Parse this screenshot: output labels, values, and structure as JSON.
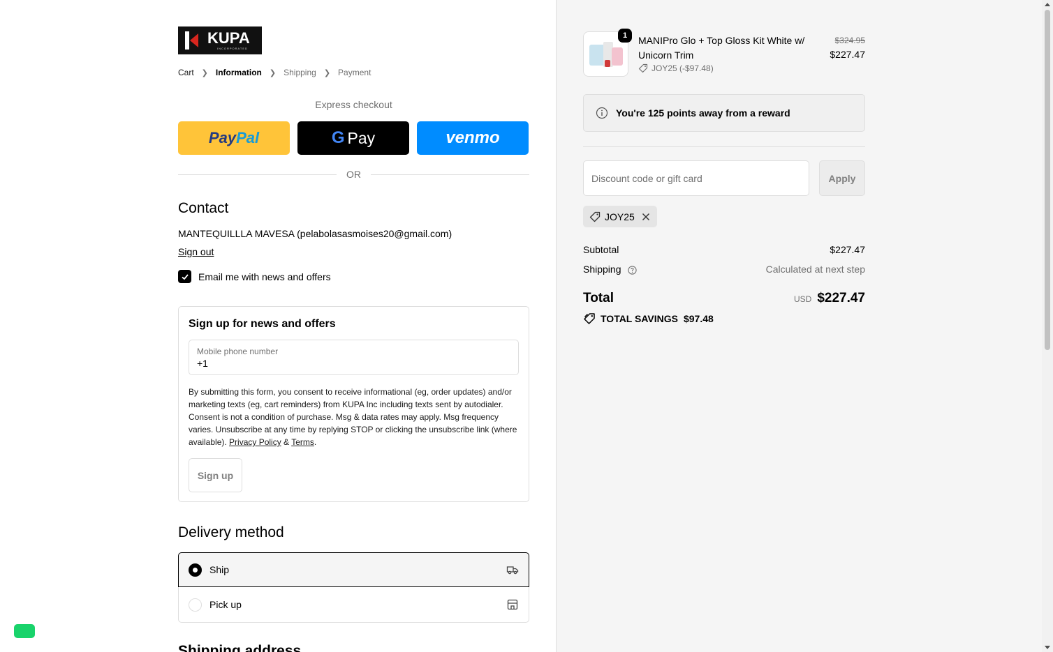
{
  "brand": {
    "logo_text": "KUPA",
    "logo_subtext": "INCORPORATED"
  },
  "breadcrumb": [
    {
      "label": "Cart",
      "state": "link"
    },
    {
      "label": "Information",
      "state": "current"
    },
    {
      "label": "Shipping",
      "state": "upcoming"
    },
    {
      "label": "Payment",
      "state": "upcoming"
    }
  ],
  "express": {
    "label": "Express checkout",
    "paypal": {
      "part1": "Pay",
      "part2": "Pal"
    },
    "gpay": {
      "g": "G",
      "pay": "Pay"
    },
    "venmo": "venmo",
    "or": "OR"
  },
  "contact": {
    "title": "Contact",
    "account": "MANTEQUILLLA MAVESA (pelabolasasmoises20@gmail.com)",
    "sign_out": "Sign out",
    "email_opt_in_label": "Email me with news and offers",
    "email_opt_in_checked": true
  },
  "sms_signup": {
    "title": "Sign up for news and offers",
    "phone_label": "Mobile phone number",
    "phone_value": "+1",
    "consent_text": "By submitting this form, you consent to receive informational (eg, order updates) and/or marketing texts (eg, cart reminders) from KUPA Inc including texts sent by autodialer. Consent is not a condition of purchase. Msg & data rates may apply. Msg frequency varies. Unsubscribe at any time by replying STOP or clicking the unsubscribe link (where available). ",
    "privacy_link": "Privacy Policy",
    "amp": " & ",
    "terms_link": "Terms",
    "period": ".",
    "button": "Sign up"
  },
  "delivery": {
    "title": "Delivery method",
    "options": [
      {
        "label": "Ship",
        "selected": true,
        "icon": "truck-icon"
      },
      {
        "label": "Pick up",
        "selected": false,
        "icon": "store-icon"
      }
    ]
  },
  "next_section_title": "Shipping address",
  "order": {
    "item": {
      "name": "MANIPro Glo + Top Gloss Kit White w/ Unicorn Trim",
      "quantity": "1",
      "discount": "JOY25 (-$97.48)",
      "original_price": "$324.95",
      "price": "$227.47"
    },
    "reward_text": "You're 125 points away from a reward",
    "discount_placeholder": "Discount code or gift card",
    "apply_label": "Apply",
    "applied_code": "JOY25",
    "subtotal_label": "Subtotal",
    "subtotal_value": "$227.47",
    "shipping_label": "Shipping",
    "shipping_value": "Calculated at next step",
    "total_label": "Total",
    "currency": "USD",
    "total_value": "$227.47",
    "savings_label": "TOTAL SAVINGS",
    "savings_value": "$97.48"
  },
  "colors": {
    "paypal_bg": "#ffc439",
    "venmo_bg": "#008cff",
    "gpay_bg": "#000000",
    "chat_widget": "#19d36b",
    "summary_bg": "#f5f5f5"
  }
}
